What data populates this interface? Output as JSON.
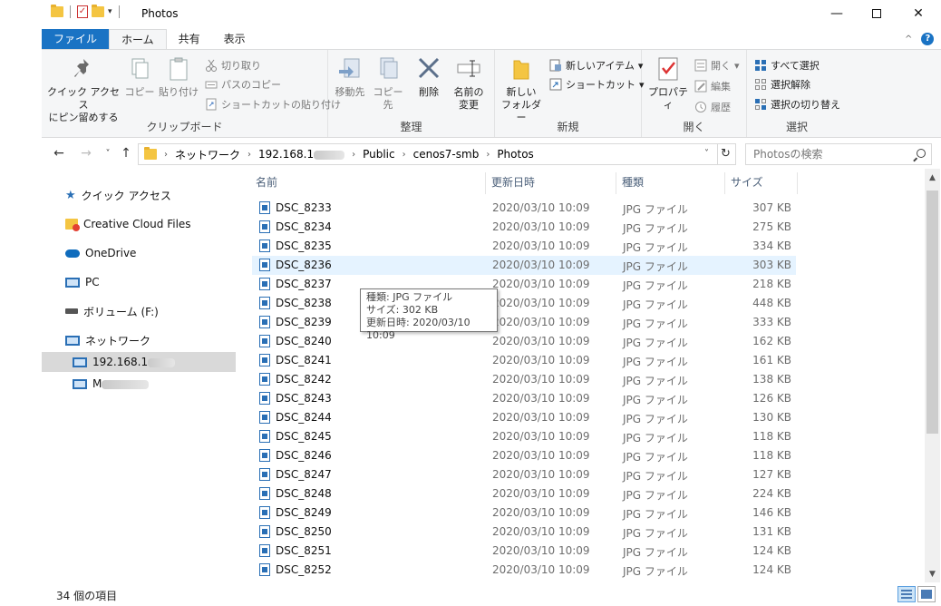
{
  "window": {
    "title": "Photos",
    "minimize": "—",
    "close": "✕"
  },
  "ribbon_tabs": [
    "ファイル",
    "ホーム",
    "共有",
    "表示"
  ],
  "ribbon": {
    "clipboard": {
      "pin_line1": "クイック アクセス",
      "pin_line2": "にピン留めする",
      "copy": "コピー",
      "paste": "貼り付け",
      "cut": "切り取り",
      "copy_path": "パスのコピー",
      "paste_shortcut": "ショートカットの貼り付け",
      "label": "クリップボード"
    },
    "organize": {
      "move_to": "移動先",
      "copy_to": "コピー先",
      "delete": "削除",
      "rename_line1": "名前の",
      "rename_line2": "変更",
      "label": "整理"
    },
    "new": {
      "new_folder_line1": "新しい",
      "new_folder_line2": "フォルダー",
      "new_item": "新しいアイテム",
      "shortcut": "ショートカット",
      "label": "新規"
    },
    "open": {
      "properties": "プロパティ",
      "open": "開く",
      "edit": "編集",
      "history": "履歴",
      "label": "開く"
    },
    "select": {
      "select_all": "すべて選択",
      "select_none": "選択解除",
      "invert": "選択の切り替え",
      "label": "選択"
    }
  },
  "address": {
    "crumbs": [
      "ネットワーク",
      "192.168.1",
      "Public",
      "cenos7-smb",
      "Photos"
    ],
    "search_placeholder": "Photosの検索"
  },
  "nav_pane": {
    "quick_access": "クイック アクセス",
    "creative_cloud": "Creative Cloud Files",
    "onedrive": "OneDrive",
    "pc": "PC",
    "volume": "ボリューム (F:)",
    "network": "ネットワーク",
    "host1": "192.168.1",
    "host2": "M"
  },
  "columns": {
    "name": "名前",
    "date": "更新日時",
    "type": "種類",
    "size": "サイズ"
  },
  "files": [
    {
      "name": "DSC_8233",
      "date": "2020/03/10 10:09",
      "type": "JPG ファイル",
      "size": "307 KB"
    },
    {
      "name": "DSC_8234",
      "date": "2020/03/10 10:09",
      "type": "JPG ファイル",
      "size": "275 KB"
    },
    {
      "name": "DSC_8235",
      "date": "2020/03/10 10:09",
      "type": "JPG ファイル",
      "size": "334 KB"
    },
    {
      "name": "DSC_8236",
      "date": "2020/03/10 10:09",
      "type": "JPG ファイル",
      "size": "303 KB"
    },
    {
      "name": "DSC_8237",
      "date": "2020/03/10 10:09",
      "type": "JPG ファイル",
      "size": "218 KB"
    },
    {
      "name": "DSC_8238",
      "date": "2020/03/10 10:09",
      "type": "JPG ファイル",
      "size": "448 KB"
    },
    {
      "name": "DSC_8239",
      "date": "2020/03/10 10:09",
      "type": "JPG ファイル",
      "size": "333 KB"
    },
    {
      "name": "DSC_8240",
      "date": "2020/03/10 10:09",
      "type": "JPG ファイル",
      "size": "162 KB"
    },
    {
      "name": "DSC_8241",
      "date": "2020/03/10 10:09",
      "type": "JPG ファイル",
      "size": "161 KB"
    },
    {
      "name": "DSC_8242",
      "date": "2020/03/10 10:09",
      "type": "JPG ファイル",
      "size": "138 KB"
    },
    {
      "name": "DSC_8243",
      "date": "2020/03/10 10:09",
      "type": "JPG ファイル",
      "size": "126 KB"
    },
    {
      "name": "DSC_8244",
      "date": "2020/03/10 10:09",
      "type": "JPG ファイル",
      "size": "130 KB"
    },
    {
      "name": "DSC_8245",
      "date": "2020/03/10 10:09",
      "type": "JPG ファイル",
      "size": "118 KB"
    },
    {
      "name": "DSC_8246",
      "date": "2020/03/10 10:09",
      "type": "JPG ファイル",
      "size": "118 KB"
    },
    {
      "name": "DSC_8247",
      "date": "2020/03/10 10:09",
      "type": "JPG ファイル",
      "size": "127 KB"
    },
    {
      "name": "DSC_8248",
      "date": "2020/03/10 10:09",
      "type": "JPG ファイル",
      "size": "224 KB"
    },
    {
      "name": "DSC_8249",
      "date": "2020/03/10 10:09",
      "type": "JPG ファイル",
      "size": "146 KB"
    },
    {
      "name": "DSC_8250",
      "date": "2020/03/10 10:09",
      "type": "JPG ファイル",
      "size": "131 KB"
    },
    {
      "name": "DSC_8251",
      "date": "2020/03/10 10:09",
      "type": "JPG ファイル",
      "size": "124 KB"
    },
    {
      "name": "DSC_8252",
      "date": "2020/03/10 10:09",
      "type": "JPG ファイル",
      "size": "124 KB"
    }
  ],
  "tooltip": {
    "type": "種類: JPG ファイル",
    "size": "サイズ: 302 KB",
    "date": "更新日時: 2020/03/10 10:09"
  },
  "status": {
    "count": "34 個の項目"
  },
  "colors": {
    "file_tab": "#1a73c4",
    "hover_row": "#e5f3ff",
    "selected_nav": "#d9d9d9"
  }
}
